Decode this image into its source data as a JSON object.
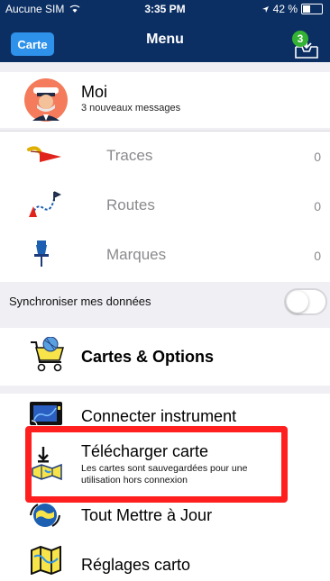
{
  "status_bar": {
    "carrier": "Aucune SIM",
    "wifi_icon": "wifi-icon",
    "time": "3:35 PM",
    "battery": "42 %",
    "battery_level_percent": 42
  },
  "nav": {
    "left_button": "Carte",
    "title": "Menu",
    "download_badge": "3",
    "download_icon": "download-tray-icon"
  },
  "profile": {
    "name": "Moi",
    "subtitle": "3 nouveaux messages",
    "avatar_icon": "captain-avatar-icon"
  },
  "records": [
    {
      "label": "Traces",
      "count": "0",
      "icon": "traces-icon"
    },
    {
      "label": "Routes",
      "count": "0",
      "icon": "routes-icon"
    },
    {
      "label": "Marques",
      "count": "0",
      "icon": "marker-pin-icon"
    }
  ],
  "sync": {
    "label": "Synchroniser mes données",
    "enabled": false
  },
  "charts": {
    "label": "Cartes & Options",
    "icon": "shopping-cart-icon"
  },
  "menu_items": [
    {
      "label": "Connecter instrument",
      "subtitle": "",
      "icon": "instrument-display-icon"
    },
    {
      "label": "Télécharger carte",
      "subtitle": "Les cartes sont sauvegardées pour une utilisation hors connexion",
      "icon": "download-map-icon"
    },
    {
      "label": "Tout Mettre à Jour",
      "subtitle": "",
      "icon": "globe-update-icon"
    },
    {
      "label": "Réglages carto",
      "subtitle": "",
      "icon": "map-settings-icon"
    }
  ],
  "colors": {
    "nav_background": "#0c2f63",
    "accent_button": "#2e92ea",
    "badge": "#34b233",
    "highlight": "#ff1f1f"
  }
}
